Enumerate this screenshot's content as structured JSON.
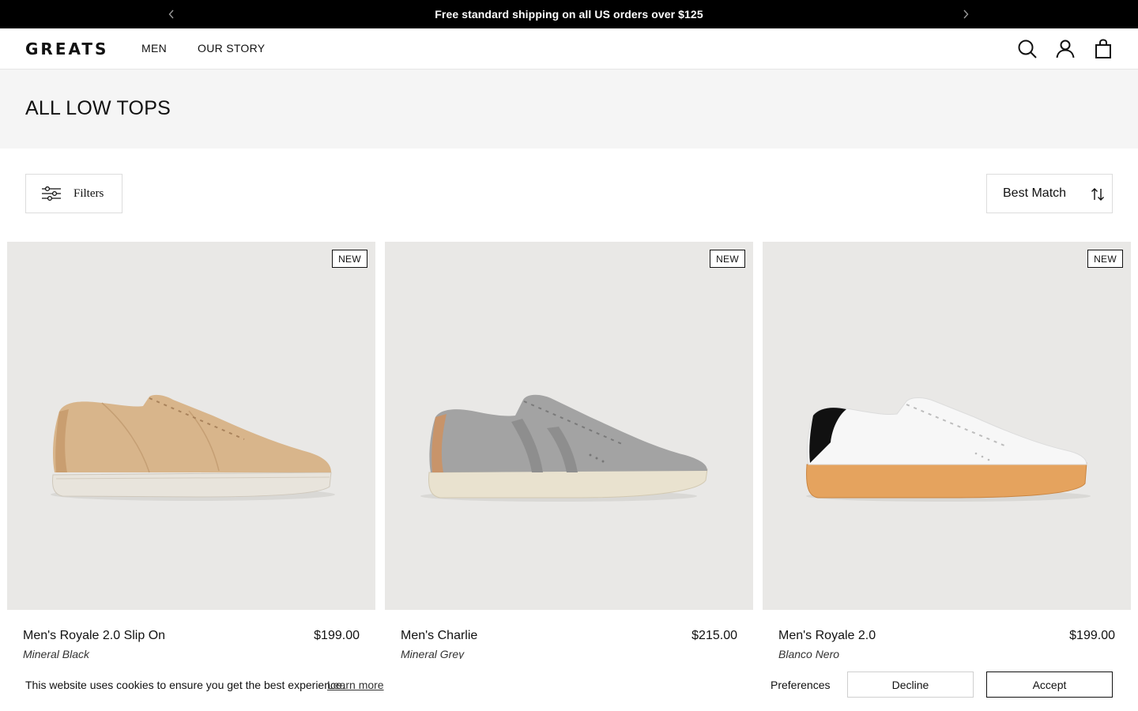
{
  "announcement": {
    "message": "Free standard shipping on all US orders over $125",
    "prev_icon": "chevron-left-icon",
    "next_icon": "chevron-right-icon"
  },
  "header": {
    "logo": "GREATS",
    "nav": [
      {
        "label": "MEN"
      },
      {
        "label": "OUR STORY"
      }
    ],
    "icons": [
      "search-icon",
      "account-icon",
      "bag-icon"
    ]
  },
  "page": {
    "title": "ALL LOW TOPS"
  },
  "toolbar": {
    "filters_label": "Filters",
    "filters_icon": "sliders-icon",
    "sort_label": "Best Match",
    "sort_icon": "sort-arrows-icon"
  },
  "products": [
    {
      "badge": "NEW",
      "name": "Men's Royale 2.0 Slip On",
      "price": "$199.00",
      "colorway": "Mineral Black"
    },
    {
      "badge": "NEW",
      "name": "Men's Charlie",
      "price": "$215.00",
      "colorway": "Mineral Grey"
    },
    {
      "badge": "NEW",
      "name": "Men's Royale 2.0",
      "price": "$199.00",
      "colorway": "Blanco Nero"
    }
  ],
  "cookie_banner": {
    "text": "This website uses cookies to ensure you get the best experience.",
    "learn_more": "Learn more",
    "preferences": "Preferences",
    "decline": "Decline",
    "accept": "Accept"
  },
  "colors": {
    "announcement_bg": "#000000",
    "title_band_bg": "#f5f5f5",
    "product_bg": "#e9e8e6"
  }
}
